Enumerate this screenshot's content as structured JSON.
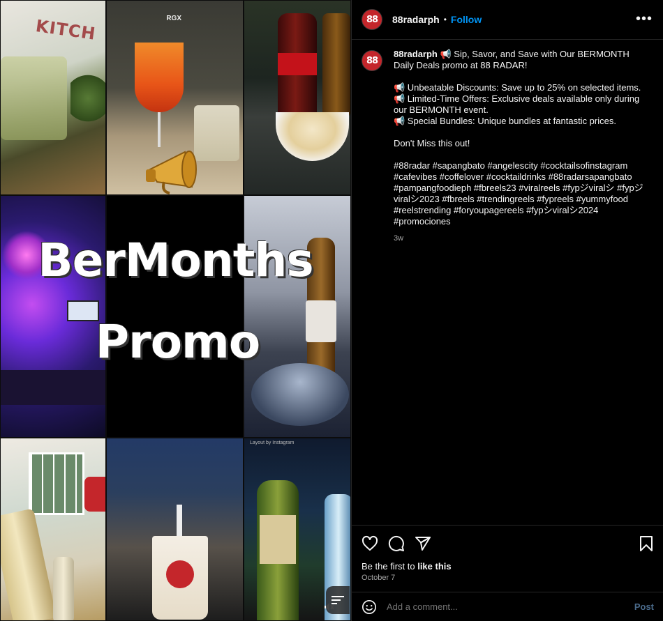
{
  "media": {
    "title_line1": "BerMonths",
    "title_line2": "Promo",
    "tile_kitchen_text": "KITCH",
    "tile_rgx_text": "RGX",
    "tile_layout_text": "Layout by Instagram"
  },
  "header": {
    "avatar_text": "88",
    "username": "88radarph",
    "separator": "•",
    "follow_label": "Follow",
    "more_icon": "more-horizontal-icon"
  },
  "caption": {
    "avatar_text": "88",
    "username": "88radarph",
    "lines": [
      "📢 Sip, Savor, and Save with Our BERMONTH Daily Deals promo at 88 RADAR!",
      "",
      "📢 Unbeatable Discounts: Save up to 25% on selected items.",
      "📢 Limited-Time Offers: Exclusive deals available only during our BERMONTH event.",
      "📢 Special Bundles: Unique bundles at fantastic prices.",
      "",
      "Don't Miss this out!",
      "",
      "#88radar #sapangbato #angelescity #cocktailsofinstagram #cafevibes #coffelover #cocktaildrinks #88radarsapangbato #pampangfoodieph #fbreels23 #viralreels #fypジviralシ #fypジviralシ2023 #fbreels #trendingreels #fypreels #yummyfood #reelstrending #foryoupagereels #fypシviralシ2024 #promociones"
    ],
    "time_ago": "3w"
  },
  "actions": {
    "like_icon": "heart-icon",
    "comment_icon": "comment-icon",
    "share_icon": "share-icon",
    "save_icon": "bookmark-icon",
    "likes_prefix": "Be the first to ",
    "likes_bold": "like this",
    "date": "October 7"
  },
  "comment": {
    "placeholder": "Add a comment...",
    "post_label": "Post"
  },
  "colors": {
    "accent": "#0095f6",
    "brand_red": "#c4262b",
    "background": "#000000",
    "muted_text": "#a8a8a8"
  }
}
